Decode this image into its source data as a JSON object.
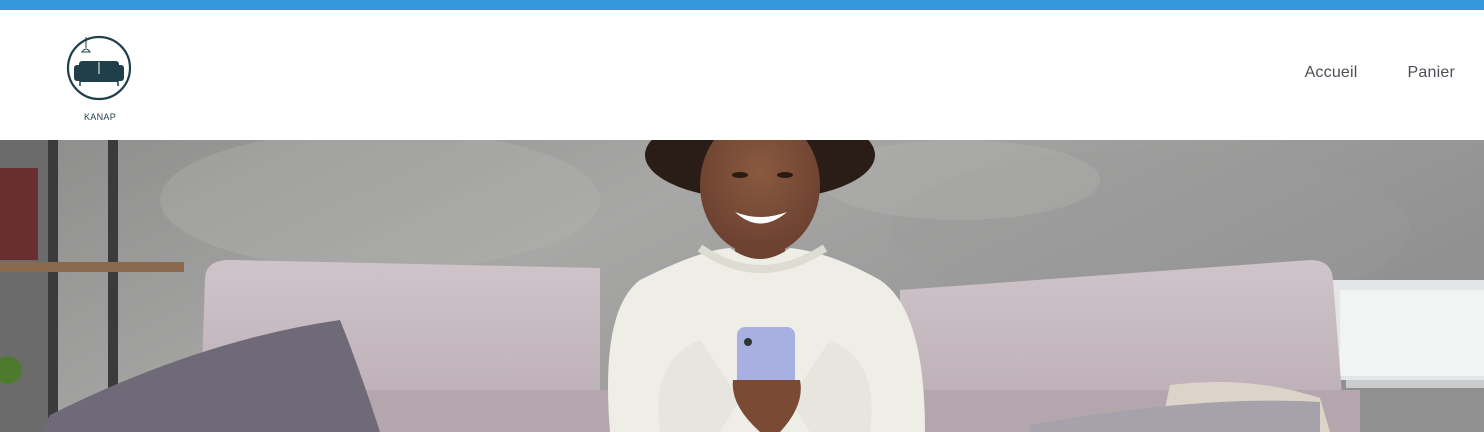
{
  "logo": {
    "text": "KANAP",
    "icon": "sofa-lamp-icon"
  },
  "nav": {
    "items": [
      {
        "label": "Accueil"
      },
      {
        "label": "Panier"
      }
    ]
  },
  "colors": {
    "accent": "#3498db",
    "brand": "#1f3f4a",
    "nav_text": "#4a4e57"
  },
  "hero": {
    "image": "woman-on-sofa-with-phone"
  }
}
